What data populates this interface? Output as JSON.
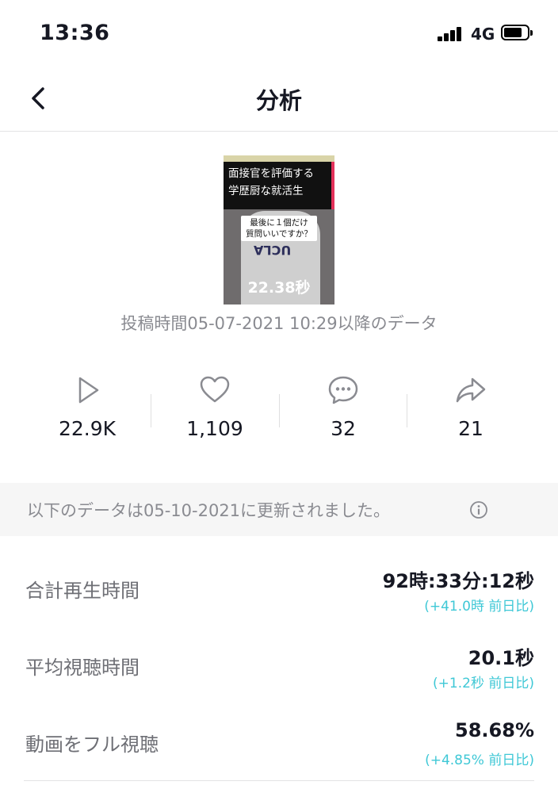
{
  "status_bar": {
    "time": "13:36",
    "network": "4G"
  },
  "header": {
    "title": "分析"
  },
  "video": {
    "caption_line1": "面接官を評価する",
    "caption_line2": "学歴厨な就活生",
    "subtitle_line1": "最後に１個だけ",
    "subtitle_line2": "質問いいですか？",
    "shirt_text": "UCLA",
    "duration": "22.38秒",
    "posted": "投稿時間05-07-2021 10:29以降のデータ"
  },
  "metrics": {
    "plays": "22.9K",
    "likes": "1,109",
    "comments": "32",
    "shares": "21"
  },
  "update_notice": "以下のデータは05-10-2021に更新されました。",
  "stats": [
    {
      "label": "合計再生時間",
      "value": "92時:33分:12秒",
      "delta": "(+41.0時 前日比)"
    },
    {
      "label": "平均視聴時間",
      "value": "20.1秒",
      "delta": "(+1.2秒 前日比)"
    },
    {
      "label": "動画をフル視聴",
      "value": "58.68%",
      "delta": "(+4.85% 前日比)"
    }
  ],
  "colors": {
    "accent_delta": "#3fc8d6",
    "text_primary": "#161823",
    "text_secondary": "#8a8b91"
  }
}
